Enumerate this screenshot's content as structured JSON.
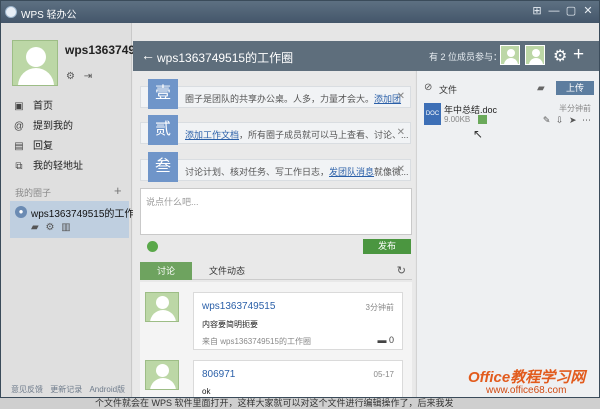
{
  "window": {
    "title": "WPS 轻办公",
    "controls": [
      "⊞",
      "—",
      "▢",
      "✕"
    ]
  },
  "sidebar": {
    "username": "wps1363749.",
    "nav": [
      {
        "label": "首页",
        "icon": "home-icon",
        "glyph": "▣"
      },
      {
        "label": "提到我的",
        "icon": "at-icon",
        "glyph": "@"
      },
      {
        "label": "回复",
        "icon": "reply-icon",
        "glyph": "▤"
      },
      {
        "label": "我的轻地址",
        "icon": "link-icon",
        "glyph": "⧉"
      }
    ],
    "group_section_label": "我的圈子",
    "group_add": "+",
    "group_name": "wps1363749515的工作...",
    "footer": [
      "意见反馈",
      "更新记录",
      "Android版"
    ]
  },
  "header": {
    "back": "←",
    "title": "wps1363749515的工作圈",
    "members_text": "有 2 位成员参与：",
    "settings": "⚙",
    "add": "+"
  },
  "tips": [
    {
      "num": "壹",
      "text_before": "圈子是团队的共享办公桌。人多，力量才会大。",
      "link": "添加团",
      "text_after": ""
    },
    {
      "num": "贰",
      "text_before": "",
      "link": "添加工作文档",
      "text_after": "，所有圈子成员就可以马上查看、讨论、..."
    },
    {
      "num": "叁",
      "text_before": "讨论计划、核对任务、写工作日志，",
      "link": "发团队消息",
      "text_after": "就像微..."
    }
  ],
  "compose": {
    "placeholder": "说点什么吧...",
    "publish_label": "发布"
  },
  "tabs": {
    "discuss": "讨论",
    "file_activity": "文件动态",
    "refresh": "↻"
  },
  "posts": [
    {
      "author": "wps1363749515",
      "time": "3分钟前",
      "body": "内容要简明扼要",
      "from": "来自 wps1363749515的工作圈",
      "comments": "0"
    },
    {
      "author": "806971",
      "time": "05-17",
      "body": "ok",
      "from": "",
      "comments": ""
    }
  ],
  "files_panel": {
    "title": "文件",
    "upload_label": "上传",
    "files": [
      {
        "type": "DOC",
        "name": "年中总结.doc",
        "size": "9.00KB",
        "time": "半分钟前"
      }
    ]
  },
  "bottom_text": "个文件就会在 WPS 软件里面打开，这样大家就可以对这个文件进行编辑操作了，后来我发",
  "watermark": {
    "big": "Office教程学习网",
    "small": "www.office68.com"
  }
}
